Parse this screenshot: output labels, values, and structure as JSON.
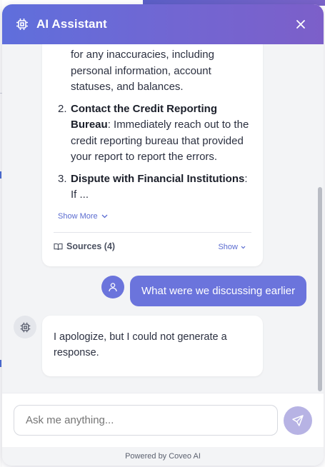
{
  "header": {
    "title": "AI Assistant",
    "close_label": "×"
  },
  "messages": {
    "assistant_1": {
      "intro": "for any inaccuracies, including personal information, account statuses, and balances.",
      "items": [
        {
          "num": "2.",
          "bold": "Contact the Credit Reporting Bureau",
          "text": ": Immediately reach out to the credit reporting bureau that provided your report to report the errors."
        },
        {
          "num": "3.",
          "bold": "Dispute with Financial Institutions",
          "text": ": If ..."
        }
      ],
      "show_more_label": "Show More",
      "sources_label": "Sources (4)",
      "sources_show_label": "Show"
    },
    "user_1": {
      "text": "What were we discussing earlier"
    },
    "assistant_2": {
      "text": "I apologize, but I could not generate a response."
    }
  },
  "input": {
    "placeholder": "Ask me anything..."
  },
  "footer": {
    "text": "Powered by Coveo AI"
  },
  "colors": {
    "header_start": "#5f6fdc",
    "header_end": "#7c5fc9",
    "user_bubble": "#6b74dc",
    "send_button": "#b7b3e4",
    "link": "#5a6bd0"
  },
  "icons": {
    "header": "cpu-chip-icon",
    "close": "close-icon",
    "user": "user-icon",
    "bot": "cpu-chip-icon",
    "send": "send-icon",
    "sources": "book-icon",
    "chevron": "chevron-down-icon"
  }
}
